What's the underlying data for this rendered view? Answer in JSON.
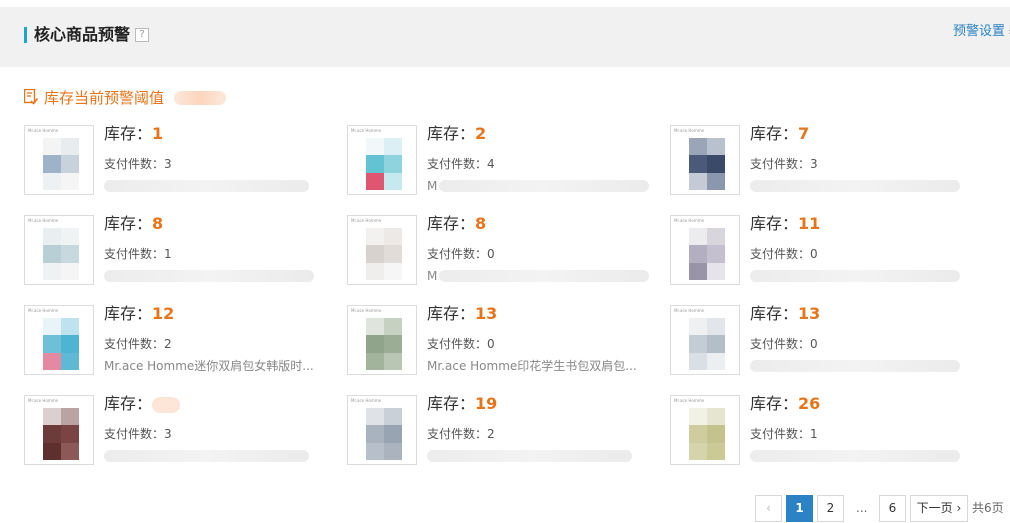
{
  "header": {
    "title": "核心商品预警",
    "help_icon": "?",
    "settings_label": "预警设置",
    "settings_arrow": "»"
  },
  "threshold": {
    "label": "库存当前预警阈值"
  },
  "stock_prefix": "库存：",
  "paid_prefix": "支付件数：",
  "items": [
    {
      "stock": "1",
      "paid": "3",
      "name": "",
      "colors": [
        "#f4f4f4",
        "#e8ecef",
        "#9fb3c8",
        "#c7d2dc",
        "#eef1f4",
        "#f5f5f5"
      ]
    },
    {
      "stock": "2",
      "paid": "4",
      "name": "M",
      "colors": [
        "#f2f8fa",
        "#dceff4",
        "#63c3d3",
        "#8fd3df",
        "#e05570",
        "#c6e9ef"
      ]
    },
    {
      "stock": "7",
      "paid": "3",
      "name": "",
      "colors": [
        "#9aa6b8",
        "#b9c1cf",
        "#4a5a78",
        "#3b4a68",
        "#c4cad6",
        "#8a97ad"
      ]
    },
    {
      "stock": "8",
      "paid": "1",
      "name": "",
      "colors": [
        "#e9eef0",
        "#f0f3f4",
        "#b8cfd6",
        "#c7d9df",
        "#eef2f3",
        "#f5f5f5"
      ]
    },
    {
      "stock": "8",
      "paid": "0",
      "name": "M",
      "colors": [
        "#f3f1f0",
        "#ece9e7",
        "#d8d2cf",
        "#e2dcd9",
        "#f0eeed",
        "#f6f6f6"
      ]
    },
    {
      "stock": "11",
      "paid": "0",
      "name": "",
      "colors": [
        "#ecebee",
        "#d8d5dc",
        "#b3aec0",
        "#c5c0d0",
        "#9a94a8",
        "#e6e4ea"
      ]
    },
    {
      "stock": "12",
      "paid": "2",
      "name": "Mr.ace Homme迷你双肩包女韩版时...",
      "colors": [
        "#e8f4f8",
        "#bfe3ee",
        "#6cc0d8",
        "#4eb4d2",
        "#e48aa0",
        "#5fb9d4"
      ]
    },
    {
      "stock": "13",
      "paid": "0",
      "name": "Mr.ace Homme印花学生书包双肩包...",
      "colors": [
        "#dfe5dc",
        "#c6d1c2",
        "#8fa48a",
        "#9bae95",
        "#a3b49d",
        "#b8c6b3"
      ]
    },
    {
      "stock": "13",
      "paid": "0",
      "name": "",
      "colors": [
        "#eef0f2",
        "#e2e6ea",
        "#c4ccd4",
        "#b4bec8",
        "#d9dfe5",
        "#eceff2"
      ]
    },
    {
      "stock": "",
      "paid": "3",
      "name": "",
      "colors": [
        "#dccfcf",
        "#b9a3a3",
        "#6e3b3b",
        "#7a4444",
        "#5e2f2f",
        "#8c5858"
      ]
    },
    {
      "stock": "19",
      "paid": "2",
      "name": "",
      "colors": [
        "#dfe3e8",
        "#c9d0d8",
        "#a9b3bf",
        "#98a4b2",
        "#b6bfca",
        "#aab3be"
      ]
    },
    {
      "stock": "26",
      "paid": "1",
      "name": "",
      "colors": [
        "#f1f1e6",
        "#e6e5cf",
        "#cfcd9e",
        "#c4c28d",
        "#d6d4ab",
        "#cbc996"
      ]
    }
  ],
  "pager": {
    "prev": "‹",
    "pages": [
      "1",
      "2",
      "6"
    ],
    "ellipsis": "...",
    "next": "下一页",
    "next_arrow": "›",
    "total": "共6页"
  },
  "thumb_brand": "Mr.ace Homme",
  "colors": {
    "accent_orange": "#e8741a",
    "link_blue": "#2b82c4",
    "title_bar": "#1aa6c9"
  }
}
